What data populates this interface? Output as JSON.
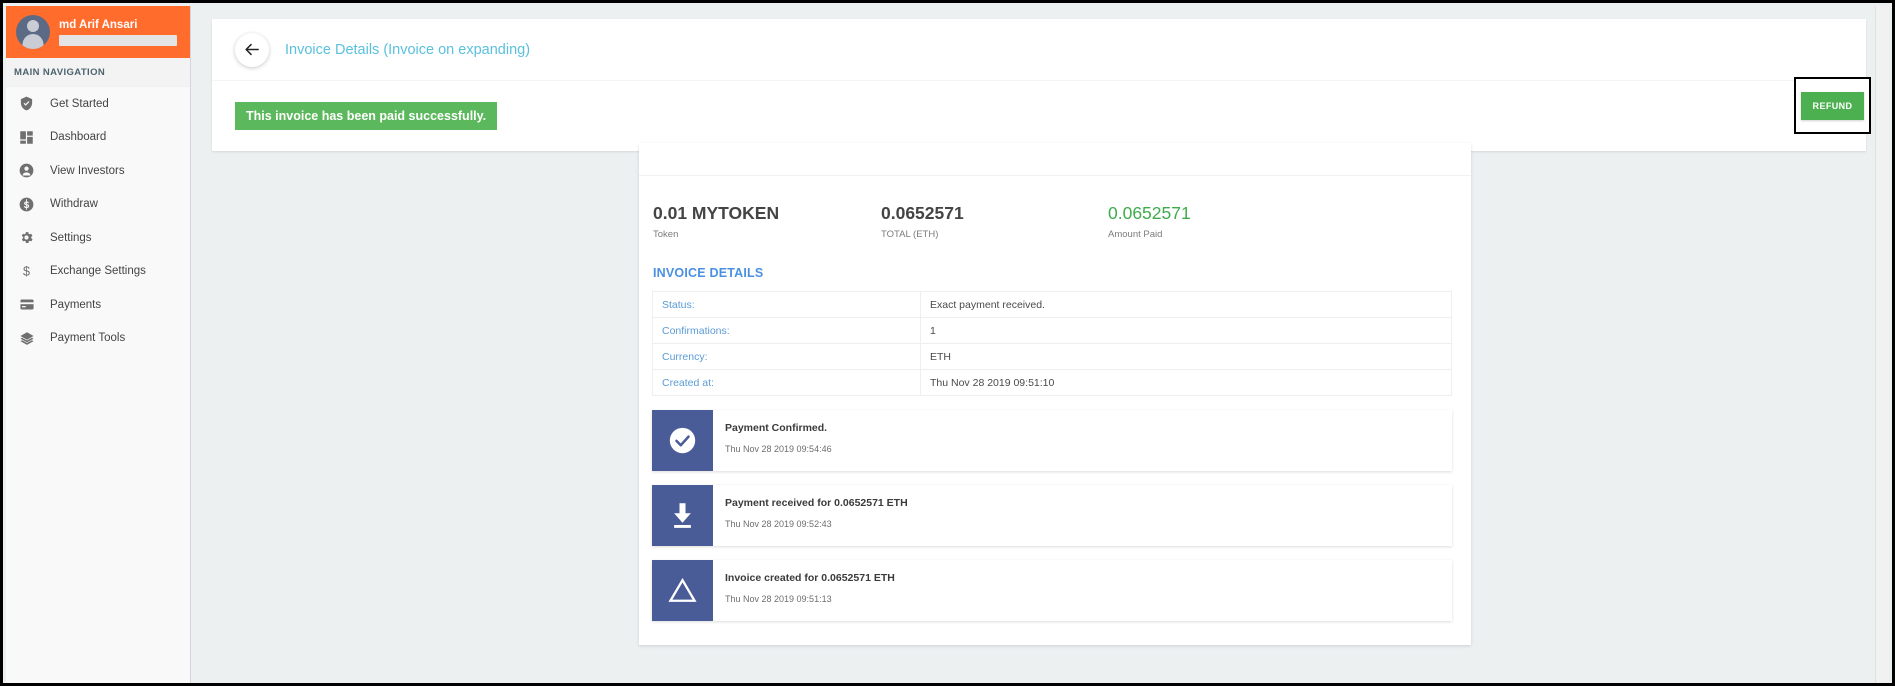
{
  "sidebar": {
    "user": {
      "name": "md Arif Ansari",
      "email_redacted": true
    },
    "nav_header": "MAIN NAVIGATION",
    "items": [
      {
        "label": "Get Started",
        "icon": "shield-icon"
      },
      {
        "label": "Dashboard",
        "icon": "dashboard-grid-icon"
      },
      {
        "label": "View Investors",
        "icon": "user-circle-icon"
      },
      {
        "label": "Withdraw",
        "icon": "dollar-circle-icon"
      },
      {
        "label": "Settings",
        "icon": "gear-icon"
      },
      {
        "label": "Exchange Settings",
        "icon": "dollar-sign-icon"
      },
      {
        "label": "Payments",
        "icon": "credit-card-icon"
      },
      {
        "label": "Payment Tools",
        "icon": "layers-icon"
      }
    ]
  },
  "header": {
    "back_icon": "arrow-left-icon",
    "title": "Invoice Details (Invoice on expanding)",
    "alert": "This invoice has been paid successfully.",
    "refund_label": "REFUND"
  },
  "invoice": {
    "summary": [
      {
        "value": "0.01 MYTOKEN",
        "label": "Token"
      },
      {
        "value": "0.0652571",
        "label": "TOTAL (ETH)"
      },
      {
        "value": "0.0652571",
        "label": "Amount Paid"
      }
    ],
    "details_title": "INVOICE DETAILS",
    "details_rows": [
      {
        "key": "Status:",
        "value": "Exact payment received."
      },
      {
        "key": "Confirmations:",
        "value": "1"
      },
      {
        "key": "Currency:",
        "value": "ETH"
      },
      {
        "key": "Created at:",
        "value": "Thu Nov 28 2019 09:51:10"
      }
    ],
    "events": [
      {
        "icon": "check-circle-icon",
        "title": "Payment Confirmed.",
        "time": "Thu Nov 28 2019 09:54:46"
      },
      {
        "icon": "download-icon",
        "title": "Payment received for 0.0652571 ETH",
        "time": "Thu Nov 28 2019 09:52:43"
      },
      {
        "icon": "triangle-icon",
        "title": "Invoice created for 0.0652571 ETH",
        "time": "Thu Nov 28 2019 09:51:13"
      }
    ]
  },
  "colors": {
    "brand_orange": "#ff6c2c",
    "success_green": "#5cb85c",
    "refund_green": "#4cb050",
    "amount_paid_green": "#3fab4c",
    "title_blue": "#5bc0de",
    "details_blue": "#4a90e2",
    "event_icon_blue": "#4a5c97",
    "page_bg": "#ecf0f1"
  }
}
